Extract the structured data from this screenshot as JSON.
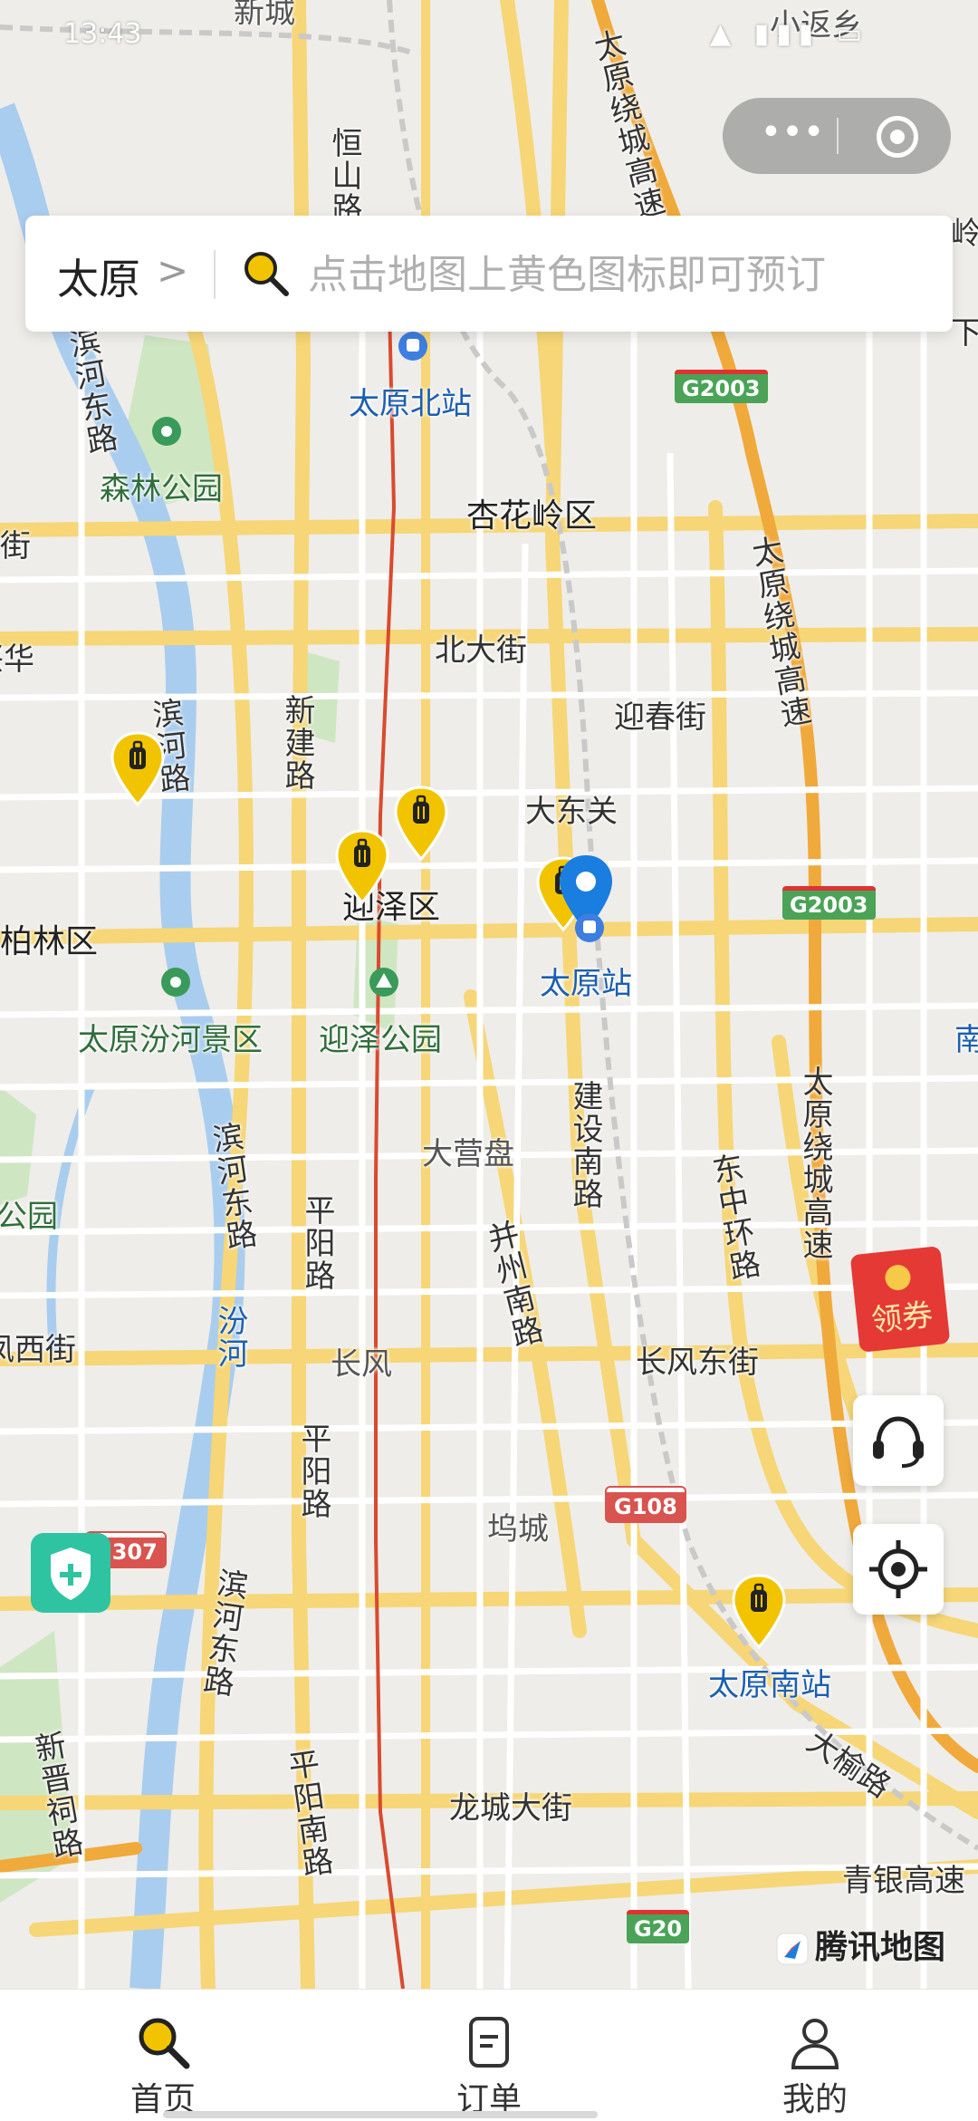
{
  "status": {
    "time": "13:43"
  },
  "search": {
    "city": "太原",
    "chevron": ">",
    "placeholder": "点击地图上黄色图标即可预订"
  },
  "map": {
    "districts": [
      "杏花岭区",
      "迎泽区",
      "万柏林区"
    ],
    "places": [
      "新城",
      "小返乡",
      "太原北站",
      "森林公园",
      "北大街",
      "迎春街",
      "大东关",
      "太原站",
      "太原汾河景区",
      "迎泽公园",
      "大营盘",
      "长风",
      "坞城",
      "太原南站",
      "兴华",
      "南",
      "岭",
      "下",
      "街",
      "凤西街",
      "公园"
    ],
    "roads": [
      "恒山路",
      "太原绕城高速",
      "滨河东路",
      "新建路",
      "滨河路",
      "建设南路",
      "并州南路",
      "东中环路",
      "平阳路",
      "长风东街",
      "龙城大街",
      "平阳南路",
      "新晋祠路",
      "大榆路",
      "青银高速",
      "汾河"
    ],
    "highway_shields": [
      "G2003",
      "G2003",
      "G108",
      "G20",
      "G307"
    ],
    "pin_icon": "luggage-pin-icon",
    "brand_yellow": "#f2c400",
    "location_blue": "#1a7de0"
  },
  "floating": {
    "coupon": "领券",
    "watermark": "腾讯地图"
  },
  "nav": {
    "tabs": [
      {
        "label": "首页",
        "icon": "search-icon",
        "active": true
      },
      {
        "label": "订单",
        "icon": "order-icon",
        "active": false
      },
      {
        "label": "我的",
        "icon": "user-icon",
        "active": false
      }
    ]
  }
}
